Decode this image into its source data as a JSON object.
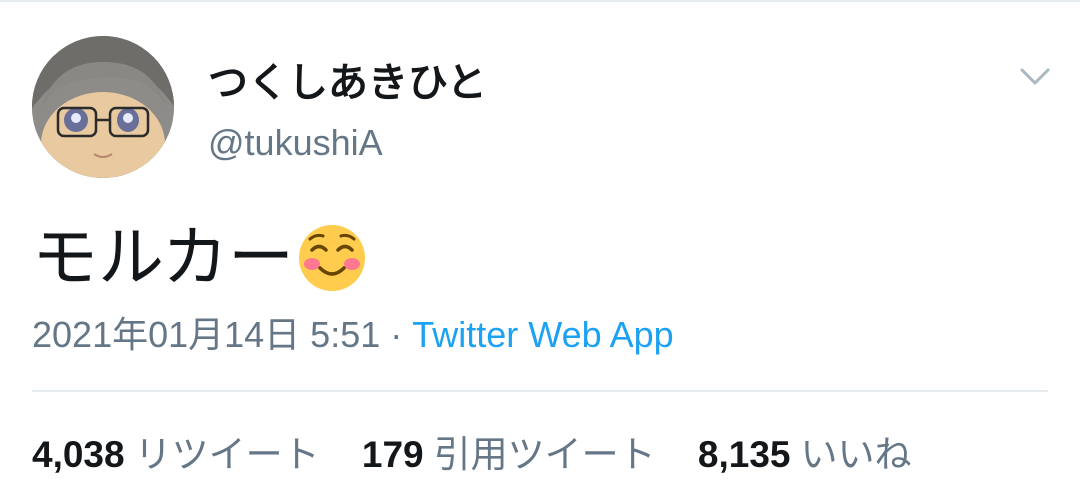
{
  "tweet": {
    "display_name": "つくしあきひと",
    "handle": "@tukushiA",
    "text": "モルカー",
    "emoji_icon": "smiling-face-with-blushing-cheeks-icon",
    "date": "2021年01月14日 5:51",
    "separator": "·",
    "source": "Twitter Web App",
    "stats": {
      "retweets": {
        "count": "4,038",
        "label": "リツイート"
      },
      "quotes": {
        "count": "179",
        "label": "引用ツイート"
      },
      "likes": {
        "count": "8,135",
        "label": "いいね"
      }
    }
  },
  "colors": {
    "text_primary": "#14171a",
    "text_secondary": "#657786",
    "link": "#1da1f2",
    "divider": "#e6ecf0"
  }
}
